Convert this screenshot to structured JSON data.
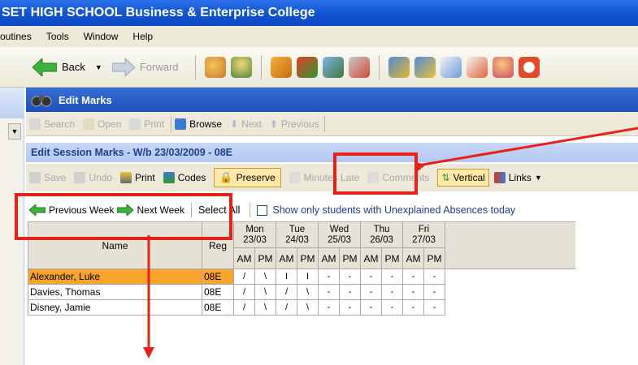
{
  "window": {
    "title": "SET HIGH SCHOOL Business & Enterprise College"
  },
  "menu": [
    "outines",
    "Tools",
    "Window",
    "Help"
  ],
  "nav": {
    "back": "Back",
    "forward": "Forward"
  },
  "edit_marks": {
    "title": "Edit Marks"
  },
  "toolbar2": {
    "search": "Search",
    "open": "Open",
    "print": "Print",
    "browse": "Browse",
    "next": "Next",
    "previous": "Previous"
  },
  "session": {
    "title": "Edit Session Marks - W/b 23/03/2009 - 08E"
  },
  "toolbar3": {
    "save": "Save",
    "undo": "Undo",
    "print": "Print",
    "codes": "Codes",
    "preserve": "Preserve",
    "minutes_late": "Minutes Late",
    "comments": "Comments",
    "vertical": "Vertical",
    "links": "Links"
  },
  "toolbar4": {
    "previous_week": "Previous Week",
    "next_week": "Next Week",
    "select_all": "Select All",
    "unexplained": "Show only students with Unexplained Absences today"
  },
  "grid": {
    "name_header": "Name",
    "reg_header": "Reg",
    "days": [
      {
        "d": "Mon",
        "date": "23/03"
      },
      {
        "d": "Tue",
        "date": "24/03"
      },
      {
        "d": "Wed",
        "date": "25/03"
      },
      {
        "d": "Thu",
        "date": "26/03"
      },
      {
        "d": "Fri",
        "date": "27/03"
      }
    ],
    "am": "AM",
    "pm": "PM",
    "rows": [
      {
        "name": "Alexander, Luke",
        "reg": "08E",
        "marks": [
          "/",
          "\\",
          "I",
          "I",
          "-",
          "-",
          "-",
          "-",
          "-",
          "-"
        ]
      },
      {
        "name": "Davies, Thomas",
        "reg": "08E",
        "marks": [
          "/",
          "\\",
          "/",
          "\\",
          "-",
          "-",
          "-",
          "-",
          "-",
          "-"
        ]
      },
      {
        "name": "Disney, Jamie",
        "reg": "08E",
        "marks": [
          "/",
          "\\",
          "/",
          "\\",
          "-",
          "-",
          "-",
          "-",
          "-",
          "-"
        ]
      }
    ]
  },
  "colors": {
    "annotation": "#e8201a",
    "selected_row": "#f7a52c"
  }
}
